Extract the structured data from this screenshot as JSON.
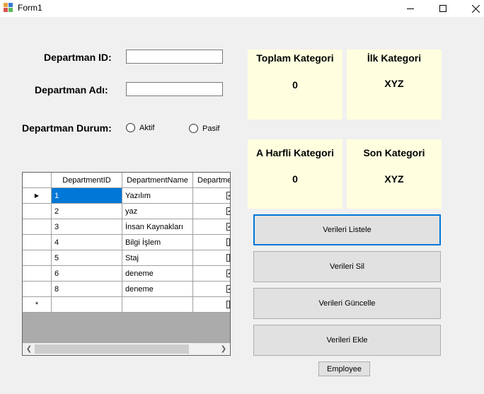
{
  "window": {
    "title": "Form1",
    "min_icon": "minimize-icon",
    "max_icon": "maximize-icon",
    "close_icon": "close-icon"
  },
  "form": {
    "id_label": "Departman ID:",
    "name_label": "Departman  Adı:",
    "status_label": "Departman Durum:",
    "id_value": "",
    "name_value": "",
    "radio_active": "Aktif",
    "radio_passive": "Pasif"
  },
  "panels": {
    "total": {
      "title": "Toplam Kategori",
      "value": "0"
    },
    "first": {
      "title": "İlk Kategori",
      "value": "XYZ"
    },
    "a_letter": {
      "title": "A Harfli Kategori",
      "value": "0"
    },
    "last": {
      "title": "Son Kategori",
      "value": "XYZ"
    }
  },
  "buttons": {
    "list": "Verileri Listele",
    "delete": "Verileri Sil",
    "update": "Verileri Güncelle",
    "add": "Verileri Ekle",
    "employee": "Employee"
  },
  "grid": {
    "columns": [
      "DepartmentID",
      "DepartmentName",
      "Departme"
    ],
    "rows": [
      {
        "id": "1",
        "name": "Yazılım",
        "checked": true
      },
      {
        "id": "2",
        "name": "yaz",
        "checked": true
      },
      {
        "id": "3",
        "name": "İnsan Kaynakları",
        "checked": true
      },
      {
        "id": "4",
        "name": "Bilgi İşlem",
        "checked": false
      },
      {
        "id": "5",
        "name": "Staj",
        "checked": false
      },
      {
        "id": "6",
        "name": "deneme",
        "checked": true
      },
      {
        "id": "8",
        "name": "deneme",
        "checked": true
      }
    ],
    "current_row_marker": "▶",
    "new_row_marker": "*"
  },
  "colors": {
    "panel_bg": "#ffffe0",
    "selection": "#0078d7",
    "form_bg": "#f0f0f0"
  }
}
